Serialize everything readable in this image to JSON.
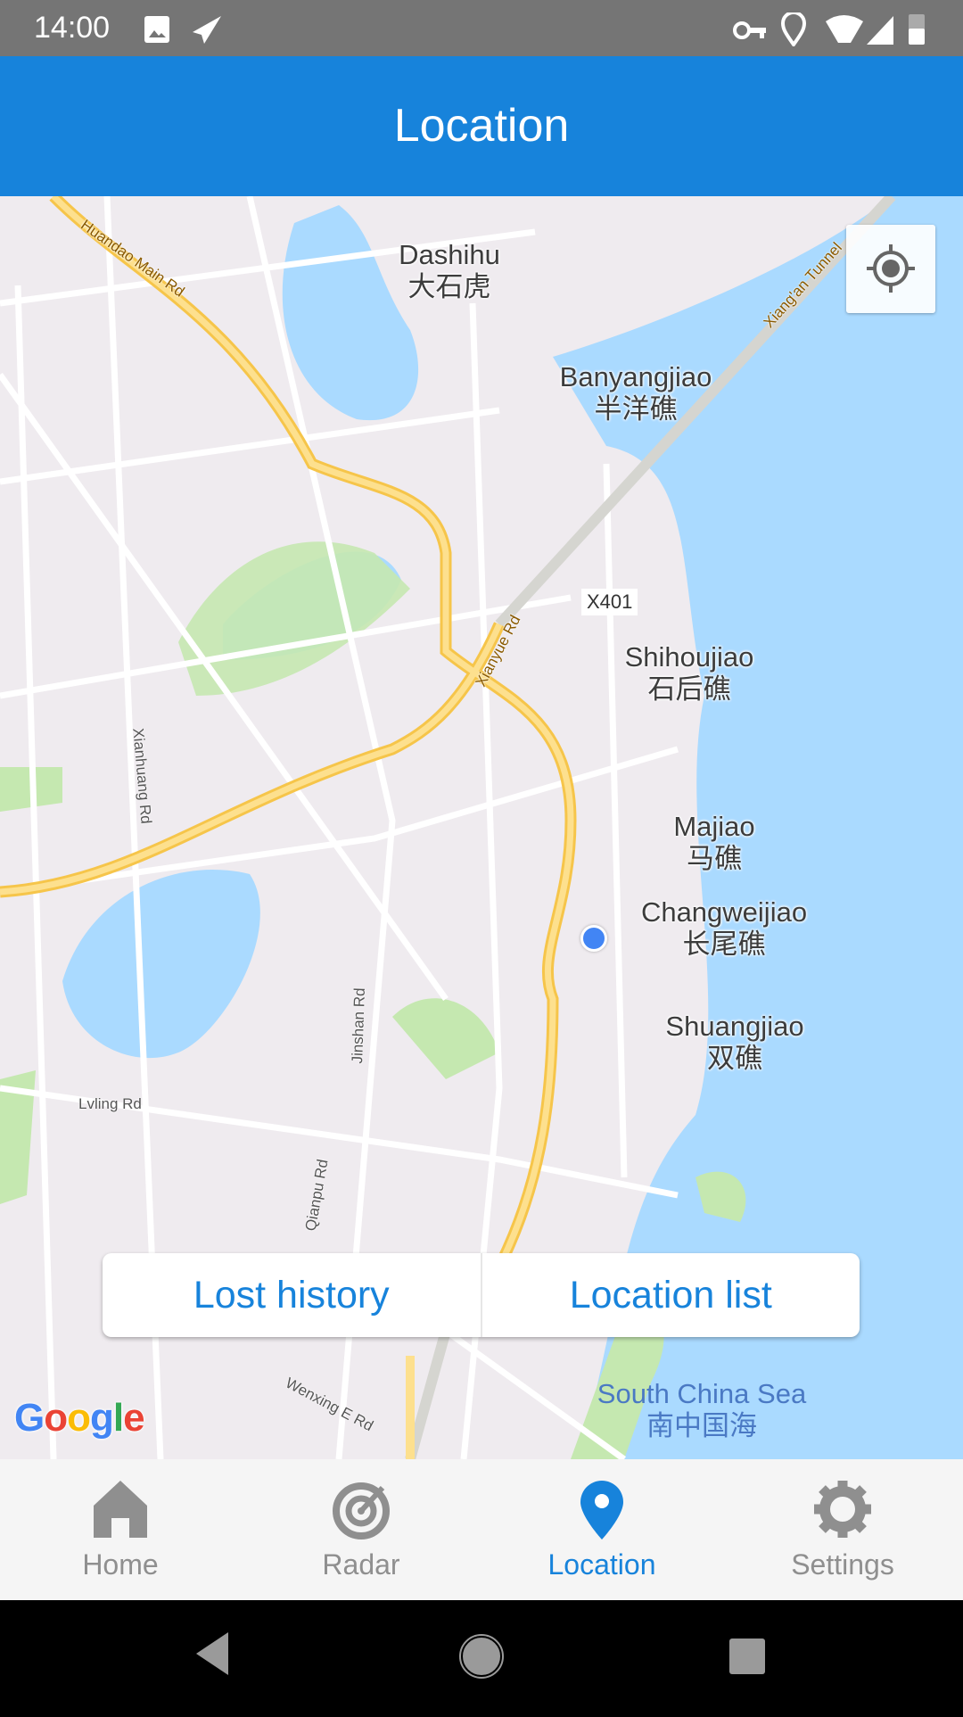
{
  "status_bar": {
    "time": "14:00",
    "left_icons": [
      "image-icon",
      "send-icon"
    ],
    "right_icons": [
      "vpn-key-icon",
      "location-pin-icon",
      "wifi-off-icon",
      "signal-icon",
      "battery-icon"
    ]
  },
  "app_bar": {
    "title": "Location"
  },
  "map": {
    "places": [
      {
        "en": "Dashihu",
        "zh": "大石虎"
      },
      {
        "en": "Banyangjiao",
        "zh": "半洋礁"
      },
      {
        "en": "Shihoujiao",
        "zh": "石后礁"
      },
      {
        "en": "Majiao",
        "zh": "马礁"
      },
      {
        "en": "Changweijiao",
        "zh": "长尾礁"
      },
      {
        "en": "Shuangjiao",
        "zh": "双礁"
      },
      {
        "en": "South China Sea",
        "zh": "南中国海"
      }
    ],
    "roads": [
      "Huandao Main Rd",
      "Xiang'an Tunnel",
      "Xianyue Rd",
      "Xianhuang Rd",
      "Jinshan Rd",
      "Lvling Rd",
      "Qianpu Rd",
      "Wenxing E Rd"
    ],
    "shield": "X401",
    "attribution": "Google",
    "colors": {
      "land": "#efebef",
      "water": "#aadaff",
      "park": "#c5e8b0",
      "highway": "#fdd77e",
      "road": "#ffffff",
      "my_location": "#4285f4"
    }
  },
  "actions": {
    "lost_history": "Lost history",
    "location_list": "Location list"
  },
  "bottom_nav": {
    "items": [
      {
        "label": "Home",
        "icon": "home-icon"
      },
      {
        "label": "Radar",
        "icon": "radar-icon"
      },
      {
        "label": "Location",
        "icon": "location-pin-icon",
        "active": true
      },
      {
        "label": "Settings",
        "icon": "gear-icon"
      }
    ],
    "active_color": "#1783db"
  }
}
